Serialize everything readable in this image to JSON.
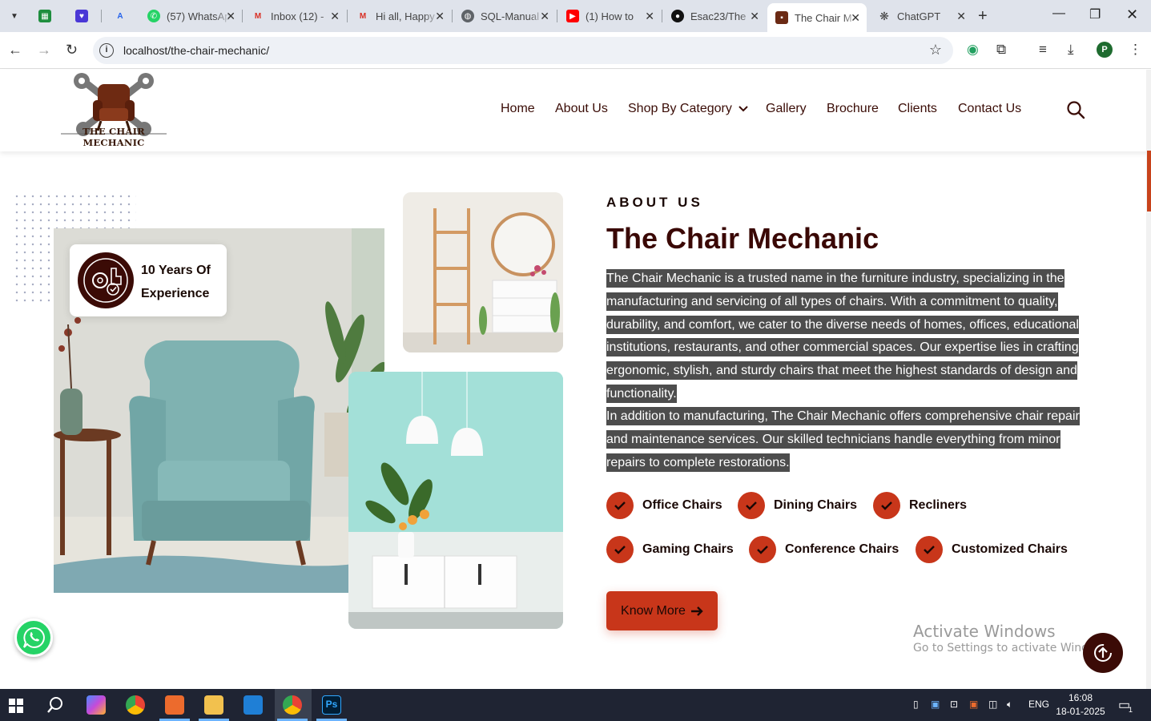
{
  "browser": {
    "tabs": [
      {
        "title": "",
        "favicon": "sheets-icon",
        "color": "#1e8e3e"
      },
      {
        "title": "",
        "favicon": "heart-shield-icon",
        "color": "#4a37d6"
      },
      {
        "title": "",
        "favicon": "translate-icon",
        "color": "#2563eb"
      },
      {
        "title": "(57) WhatsApp",
        "favicon": "whatsapp-icon",
        "color": "#25d366"
      },
      {
        "title": "Inbox (12) -",
        "favicon": "gmail-icon",
        "color": "#d93025"
      },
      {
        "title": "Hi all, Happy",
        "favicon": "gmail-icon",
        "color": "#d93025"
      },
      {
        "title": "SQL-Manual",
        "favicon": "globe-icon",
        "color": "#5f6368"
      },
      {
        "title": "(1) How to",
        "favicon": "youtube-icon",
        "color": "#ff0000"
      },
      {
        "title": "Esac23/The",
        "favicon": "github-icon",
        "color": "#111111"
      },
      {
        "title": "The Chair M",
        "favicon": "chair-icon",
        "color": "#6b2a14"
      },
      {
        "title": "ChatGPT",
        "favicon": "openai-icon",
        "color": "#444444"
      }
    ],
    "url": "localhost/the-chair-mechanic/",
    "profile_initial": "P"
  },
  "site": {
    "logo_text": "THE CHAIR MECHANIC",
    "nav": [
      "Home",
      "About Us",
      "Shop By Category",
      "Gallery",
      "Brochure",
      "Clients",
      "Contact Us"
    ],
    "accent": "#c8361a",
    "dark": "#3b0b06"
  },
  "experience": {
    "line1": "10 Years Of",
    "line2": "Experience"
  },
  "about": {
    "eyebrow": "ABOUT US",
    "title": "The Chair Mechanic",
    "para1": "The Chair Mechanic is a trusted name in the furniture industry, specializing in the manufacturing and servicing of all types of chairs. With a commitment to quality, durability, and comfort, we cater to the diverse needs of homes, offices, educational institutions, restaurants, and other commercial spaces. Our expertise lies in crafting ergonomic, stylish, and sturdy chairs that meet the highest standards of design and functionality.",
    "para2": "In addition to manufacturing, The Chair Mechanic offers comprehensive chair repair and maintenance services. Our skilled technicians handle everything from minor repairs to complete restorations.",
    "features": [
      "Office Chairs",
      "Dining Chairs",
      "Recliners",
      "Gaming Chairs",
      "Conference Chairs",
      "Customized Chairs"
    ],
    "cta": "Know More"
  },
  "watermark": {
    "line1": "Activate Windows",
    "line2": "Go to Settings to activate Windows."
  },
  "taskbar": {
    "language": "ENG",
    "time": "16:08",
    "date": "18-01-2025",
    "notifications": "1"
  }
}
